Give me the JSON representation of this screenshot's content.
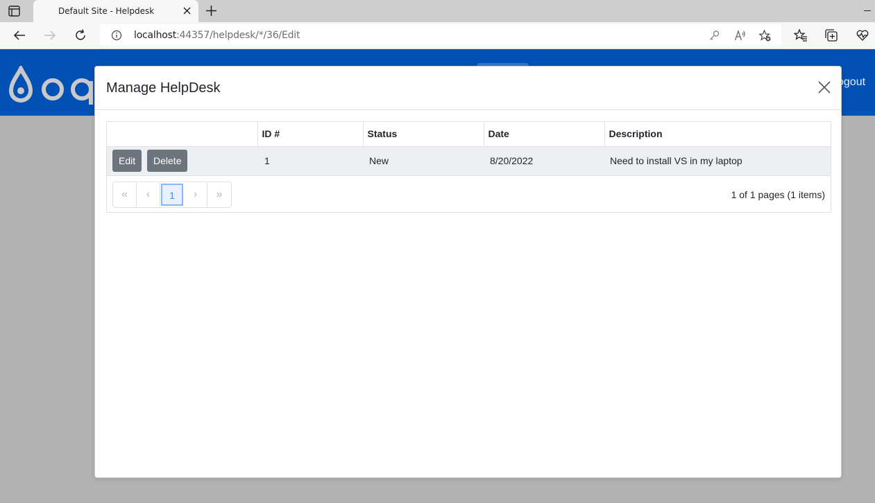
{
  "browser": {
    "tab_title": "Default Site - Helpdesk",
    "url_host": "localhost",
    "url_rest": ":44357/helpdesk/*/36/Edit"
  },
  "site": {
    "logo_text": "oqt",
    "logout_label": "ogout",
    "header_color": "#0051b3"
  },
  "modal": {
    "title": "Manage HelpDesk",
    "columns": [
      "",
      "ID #",
      "Status",
      "Date",
      "Description"
    ],
    "rows": [
      {
        "edit_label": "Edit",
        "delete_label": "Delete",
        "id": "1",
        "status": "New",
        "date": "8/20/2022",
        "description": "Need to install VS in my laptop"
      }
    ],
    "pager": {
      "first": "«",
      "prev": "‹",
      "current": "1",
      "next": "›",
      "last": "»",
      "info": "1 of 1 pages (1 items)"
    }
  }
}
